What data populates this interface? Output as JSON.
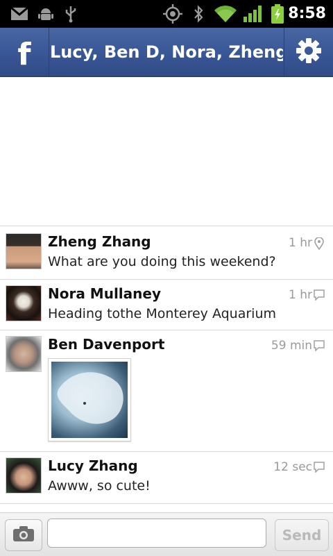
{
  "status_bar": {
    "time": "8:58",
    "icons": [
      "gmail-icon",
      "android-icon",
      "usb-icon",
      "gps-icon",
      "bluetooth-icon",
      "wifi-icon",
      "signal-icon",
      "battery-icon"
    ]
  },
  "header": {
    "logo": "f",
    "title": "Lucy, Ben D, Nora, Zheng",
    "settings_icon": "gear-icon",
    "colors": {
      "bar": "#3b5998"
    }
  },
  "messages": [
    {
      "sender": "Zheng Zhang",
      "text": "What are you doing this weekend?",
      "time": "1 hr",
      "meta_icon": "location-pin-icon"
    },
    {
      "sender": "Nora Mullaney",
      "text": "Heading tothe Monterey Aquarium",
      "time": "1 hr",
      "meta_icon": "chat-bubble-icon"
    },
    {
      "sender": "Ben Davenport",
      "text": "",
      "time": "59 min",
      "meta_icon": "chat-bubble-icon",
      "attachment": "photo"
    },
    {
      "sender": "Lucy Zhang",
      "text": "Awww, so cute!",
      "time": "12 sec",
      "meta_icon": "chat-bubble-icon"
    }
  ],
  "composer": {
    "camera_icon": "camera-icon",
    "input_value": "",
    "input_placeholder": "",
    "send_label": "Send"
  }
}
